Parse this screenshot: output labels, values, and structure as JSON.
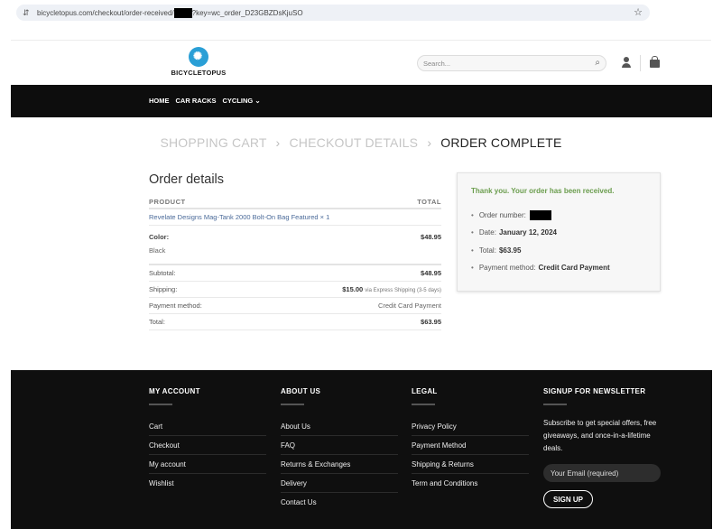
{
  "browser": {
    "url_prefix": "bicycletopus.com/checkout/order-received/",
    "url_suffix": "?key=wc_order_D23GBZDsKjuSO",
    "tune_icon": "tune-icon",
    "star_icon": "star-icon"
  },
  "header": {
    "logo_text": "BICYCLETOPUS",
    "search_placeholder": "Search...",
    "icons": [
      "search-icon",
      "user-icon",
      "cart-icon"
    ]
  },
  "nav": {
    "items": [
      {
        "label": "HOME"
      },
      {
        "label": "CAR RACKS"
      },
      {
        "label": "CYCLING ⌄"
      }
    ]
  },
  "steps": {
    "step1": "SHOPPING CART",
    "step2": "CHECKOUT DETAILS",
    "step3": "ORDER COMPLETE",
    "separator": "›"
  },
  "order_details": {
    "title": "Order details",
    "col_product": "PRODUCT",
    "col_total": "TOTAL",
    "product": "Revelate Designs Mag-Tank 2000 Bolt-On Bag Featured × 1",
    "color_label": "Color:",
    "color_value": "Black",
    "item_total": "$48.95",
    "subtotal_label": "Subtotal:",
    "subtotal_value": "$48.95",
    "shipping_label": "Shipping:",
    "shipping_value": "$15.00",
    "shipping_note": "via Express Shipping (3-5 days)",
    "payment_label": "Payment method:",
    "payment_value": "Credit Card Payment",
    "total_label": "Total:",
    "total_value": "$63.95"
  },
  "confirmation": {
    "thanks": "Thank you. Your order has been received.",
    "order_number_label": "Order number:",
    "date_label": "Date:",
    "date_value": "January 12, 2024",
    "total_label": "Total:",
    "total_value": "$63.95",
    "payment_label": "Payment method:",
    "payment_value": "Credit Card Payment"
  },
  "footer": {
    "account": {
      "title": "MY ACCOUNT",
      "links": [
        "Cart",
        "Checkout",
        "My account",
        "Wishlist"
      ]
    },
    "about": {
      "title": "ABOUT US",
      "links": [
        "About Us",
        "FAQ",
        "Returns & Exchanges",
        "Delivery",
        "Contact Us"
      ]
    },
    "legal": {
      "title": "LEGAL",
      "links": [
        "Privacy Policy",
        "Payment Method",
        "Shipping & Returns",
        "Term and Conditions"
      ]
    },
    "newsletter": {
      "title": "SIGNUP FOR NEWSLETTER",
      "text": "Subscribe to get special offers, free giveaways, and once-in-a-lifetime deals.",
      "email_placeholder": "Your Email (required)",
      "button": "SIGN UP"
    }
  }
}
